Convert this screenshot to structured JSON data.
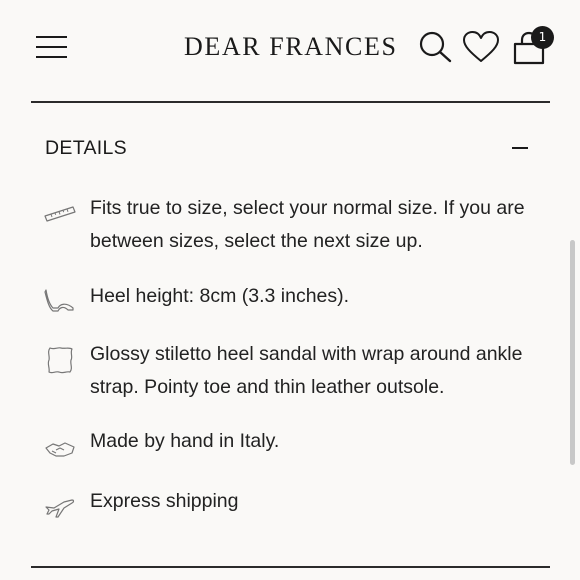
{
  "header": {
    "brand": "DEAR FRANCES",
    "bag_count": "1"
  },
  "details": {
    "heading": "DETAILS",
    "items": [
      {
        "icon": "ruler-icon",
        "text": "Fits true to size, select your normal size. If you are between sizes, select the next size up."
      },
      {
        "icon": "heel-icon",
        "text": "Heel height: 8cm (3.3 inches)."
      },
      {
        "icon": "leather-hide-icon",
        "text": "Glossy stiletto heel sandal with wrap around ankle strap. Pointy toe and thin leather outsole."
      },
      {
        "icon": "handshake-icon",
        "text": "Made by hand in Italy."
      },
      {
        "icon": "airplane-icon",
        "text": "Express shipping"
      }
    ]
  },
  "colors": {
    "background": "#faf9f7",
    "text": "#1a1a1a",
    "badge": "#1a1a1a"
  }
}
